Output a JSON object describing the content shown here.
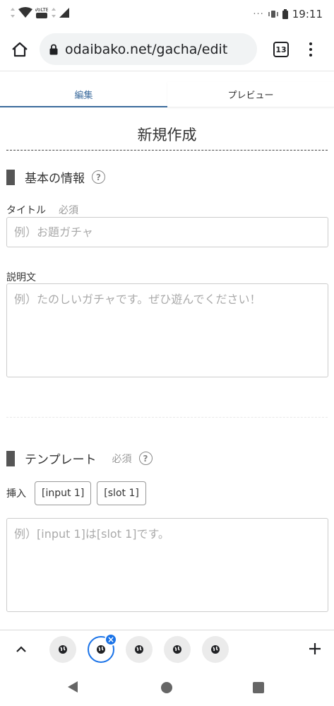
{
  "status_bar": {
    "time": "19:11",
    "overflow_dots": "···"
  },
  "browser": {
    "url": "odaibako.net/gacha/edit",
    "tab_count": "13"
  },
  "tabs": [
    {
      "label": "編集"
    },
    {
      "label": "プレビュー"
    }
  ],
  "page_title": "新規作成",
  "basic_section": {
    "heading": "基本の情報",
    "help": "?",
    "title_label": "タイトル",
    "title_required": "必須",
    "title_placeholder": "例）お題ガチャ",
    "description_label": "説明文",
    "description_placeholder": "例）たのしいガチャです。ぜひ遊んでください！"
  },
  "template_section": {
    "heading": "テンプレート",
    "required": "必須",
    "help": "?",
    "insert_label": "挿入",
    "insert_chips": [
      "[input 1]",
      "[slot 1]"
    ],
    "template_placeholder": "例）[input 1]は[slot 1]です。"
  },
  "tab_strip": {
    "close_badge": "×",
    "tab_favicons": [
      "globe-icon",
      "globe-icon",
      "globe-icon",
      "globe-icon",
      "globe-icon"
    ],
    "selected_index": 1
  },
  "colors": {
    "accent": "#3a6a9c",
    "chrome_blue": "#1a73e8",
    "section_bar": "#555555"
  }
}
